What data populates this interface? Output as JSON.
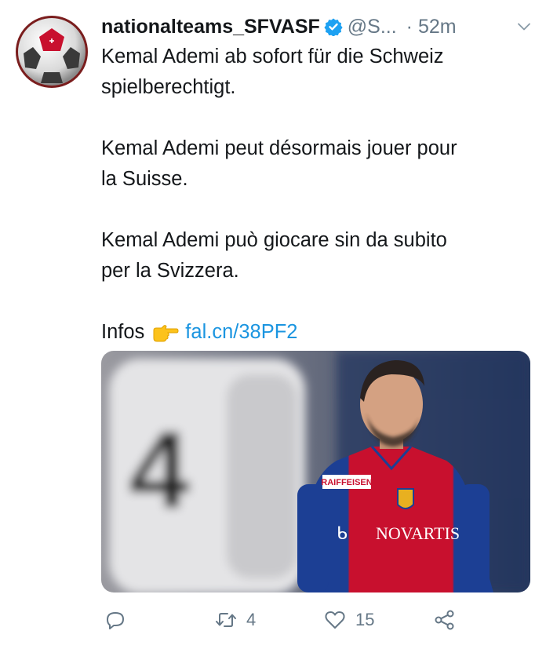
{
  "tweet": {
    "author": {
      "display_name": "nationalteams_SFVASF",
      "handle": "@S...",
      "verified": true,
      "avatar_icon": "football-avatar-icon"
    },
    "separator": "·",
    "time": "52m",
    "text": {
      "paragraph_1_line_1": "Kemal Ademi ab sofort für die Schweiz",
      "paragraph_1_line_2": "spielberechtigt.",
      "paragraph_2_line_1": "Kemal Ademi peut désormais jouer pour",
      "paragraph_2_line_2": "la Suisse.",
      "paragraph_3_line_1": "Kemal Ademi può giocare sin da subito",
      "paragraph_3_line_2": "per la Svizzera.",
      "infos_label": "Infos",
      "infos_emoji": "backhand-index-pointing-right",
      "link": "fal.cn/38PF2"
    },
    "media": {
      "jersey_number": "4",
      "shirt_sponsor": "RAIFFEISEN",
      "shirt_main_sponsor": "NOVARTIS"
    },
    "actions": {
      "reply_count": "",
      "retweet_count": "4",
      "like_count": "15"
    }
  },
  "colors": {
    "link": "#1b95e0",
    "secondary_text": "#657786",
    "verified_badge": "#1da1f2",
    "jersey_red": "#c8102e",
    "jersey_blue": "#1c3f94"
  }
}
